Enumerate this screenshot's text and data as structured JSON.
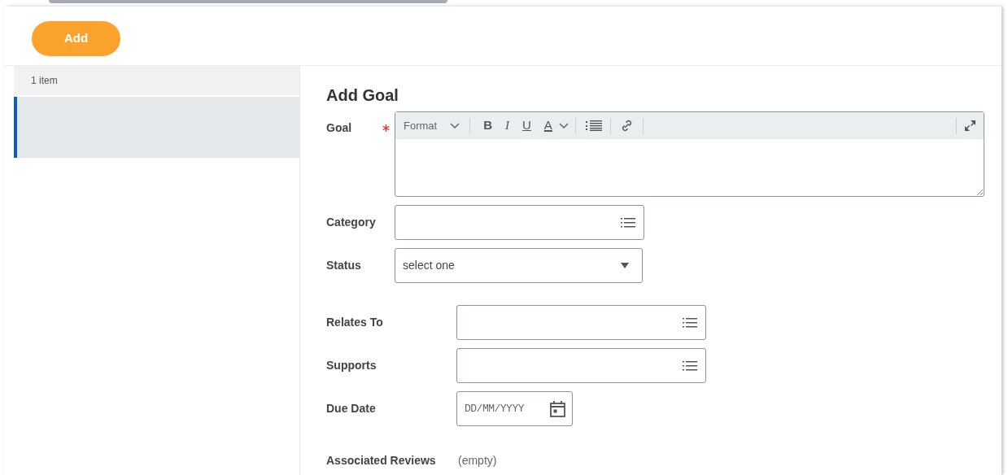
{
  "add_button": "Add",
  "list": {
    "count": "1 item",
    "items": [
      {
        "selected": true
      }
    ]
  },
  "form": {
    "title": "Add Goal",
    "sections": [
      {
        "fields": [
          {
            "kind": "richtext",
            "label": "Goal",
            "required": true,
            "toolbar": {
              "format": "Format",
              "buttons": [
                "B",
                "I",
                "U",
                "A"
              ]
            }
          },
          {
            "kind": "prompt",
            "label": "Category",
            "required": false
          },
          {
            "kind": "select",
            "label": "Status",
            "required": false,
            "value": "select one"
          }
        ]
      },
      {
        "fields": [
          {
            "kind": "prompt",
            "label": "Relates To",
            "required": false
          },
          {
            "kind": "prompt",
            "label": "Supports",
            "required": false
          },
          {
            "kind": "date",
            "label": "Due Date",
            "required": false,
            "placeholder": "DD/MM/YYYY"
          },
          {
            "kind": "readonly",
            "label": "Associated Reviews",
            "required": false,
            "value": "(empty)"
          }
        ]
      }
    ]
  }
}
